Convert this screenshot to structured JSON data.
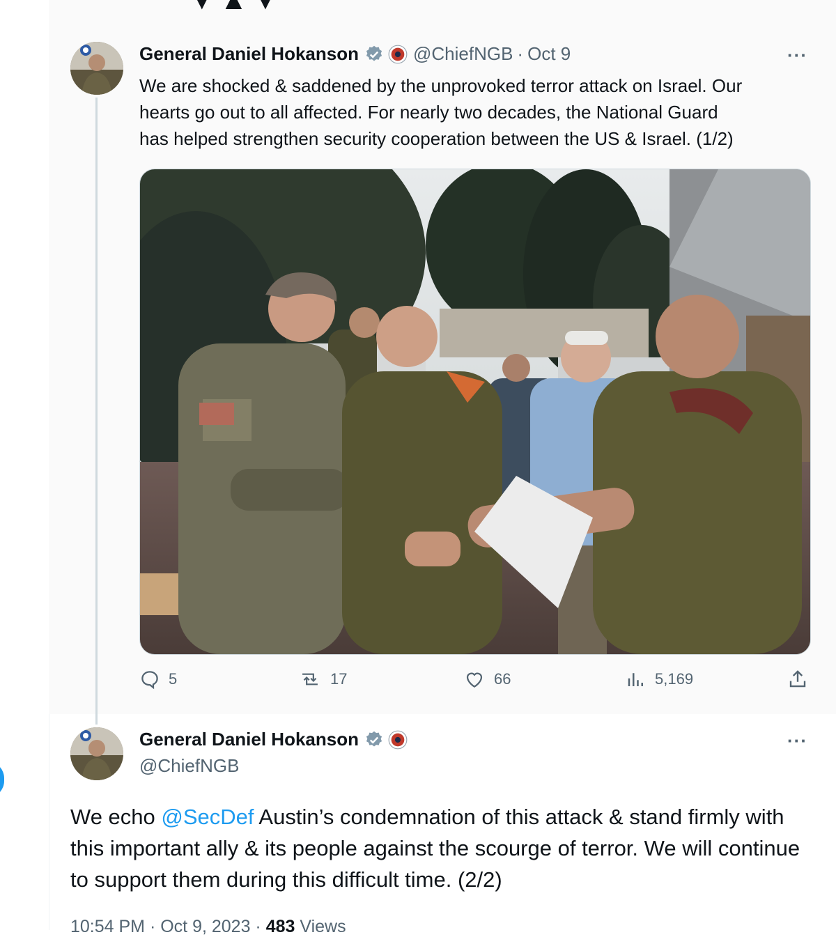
{
  "tweet1": {
    "author_name": "General Daniel Hokanson",
    "handle": "@ChiefNGB",
    "separator": "·",
    "date": "Oct 9",
    "more": "···",
    "text_lines": [
      "We are shocked & saddened by the unprovoked terror attack on Israel. Our",
      "hearts go out to all affected. For nearly two decades, the National Guard",
      "has helped strengthen security cooperation between the US & Israel. (1/2)"
    ],
    "media_icon": "photo-of-military-officers-meeting",
    "actions": {
      "replies": "5",
      "reposts": "17",
      "likes": "66",
      "views": "5,169"
    }
  },
  "tweet2": {
    "author_name": "General Daniel Hokanson",
    "handle": "@ChiefNGB",
    "more": "···",
    "text_before": "We echo ",
    "mention": "@SecDef",
    "text_after": " Austin’s condemnation of this attack & stand firmly with this important ally & its people against the scourge of terror. We will continue to support them during this difficult time. (2/2)",
    "meta": {
      "time": "10:54 PM",
      "sep1": " · ",
      "date": "Oct 9, 2023",
      "sep2": " · ",
      "views": "483",
      "views_label": " Views"
    }
  },
  "colors": {
    "text": "#0f1419",
    "secondary": "#536471",
    "accent": "#1d9bf0",
    "verified_gray": "#829aab"
  }
}
